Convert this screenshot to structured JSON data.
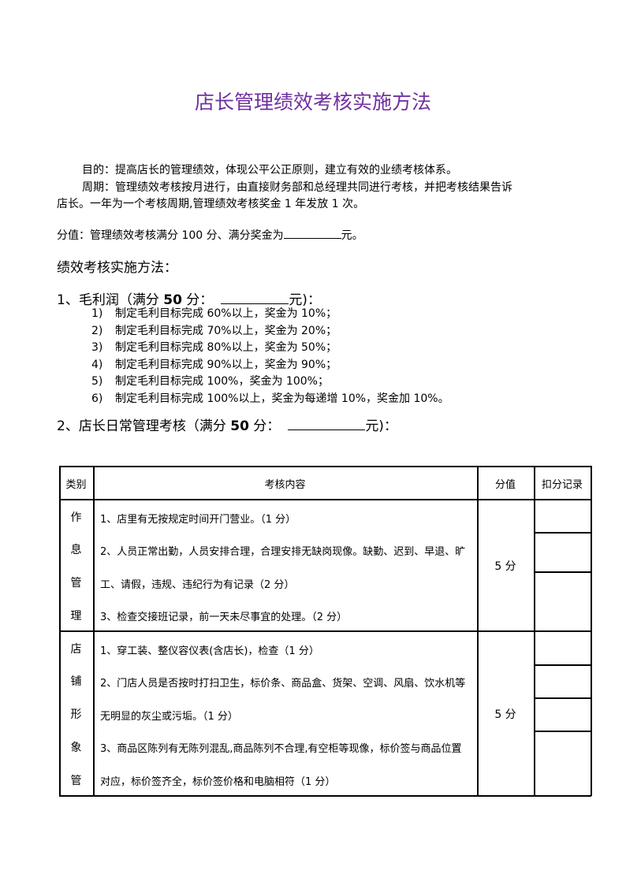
{
  "document": {
    "title": "店长管理绩效考核实施方法",
    "title_color": "#7030a0",
    "purpose": "目的：提高店长的管理绩效，体现公平公正原则，建立有效的业绩考核体系。",
    "period_line1": "周期：管理绩效考核按月进行，由直接财务部和总经理共同进行考核，并把考核结果告诉",
    "period_line2": "店长。一年为一个考核周期,管理绩效考核奖金 1 年发放 1 次。",
    "score_prefix": "分值：管理绩效考核满分 100 分、满分奖金为",
    "score_suffix": "元。",
    "method_heading": "绩效考核实施方法：",
    "section1": {
      "prefix": "1、毛利润（满分 ",
      "bold": "50",
      "middle": " 分：",
      "suffix": "元)：",
      "items": [
        {
          "num": "1)",
          "text": "制定毛利目标完成 60%以上，奖金为 10%；"
        },
        {
          "num": "2)",
          "text": "制定毛利目标完成 70%以上，奖金为 20%；"
        },
        {
          "num": "3)",
          "text": "制定毛利目标完成 80%以上，奖金为 50%；"
        },
        {
          "num": "4)",
          "text": "制定毛利目标完成 90%以上，奖金为 90%；"
        },
        {
          "num": "5)",
          "text": "制定毛利目标完成 100%，奖金为 100%；"
        },
        {
          "num": "6)",
          "text": "制定毛利目标完成 100%以上，奖金为每递增 10%，奖金加 10%。"
        }
      ]
    },
    "section2": {
      "prefix": "2、店长日常管理考核（满分 ",
      "bold": "50",
      "middle": " 分：",
      "suffix": "元)："
    }
  },
  "table": {
    "headers": [
      "类别",
      "考核内容",
      "分值",
      "扣分记录"
    ],
    "groups": [
      {
        "category_chars": [
          "作",
          "息",
          "管",
          "理"
        ],
        "lines": [
          "1、店里有无按规定时间开门营业。（1 分）",
          "2、人员正常出勤，人员安排合理，合理安排无缺岗现像。缺勤、迟到、早退、旷",
          "工、请假，违规、违纪行为有记录（2 分）",
          "3、检查交接班记录，前一天未尽事宜的处理。（2 分）"
        ],
        "score": "5 分"
      },
      {
        "category_chars": [
          "店",
          "铺",
          "形",
          "象",
          "管"
        ],
        "lines": [
          "1、穿工装、整仪容仪表(含店长)，检查（1 分）",
          "2、门店人员是否按时打扫卫生，标价条、商品盒、货架、空调、风扇、饮水机等",
          "无明显的灰尘或污垢。（1 分）",
          "3、商品区陈列有无陈列混乱,商品陈列不合理,有空柜等现像，标价签与商品位置",
          "对应，标价签齐全，标价签价格和电脑相符（1 分）"
        ],
        "score": "5 分"
      }
    ]
  }
}
